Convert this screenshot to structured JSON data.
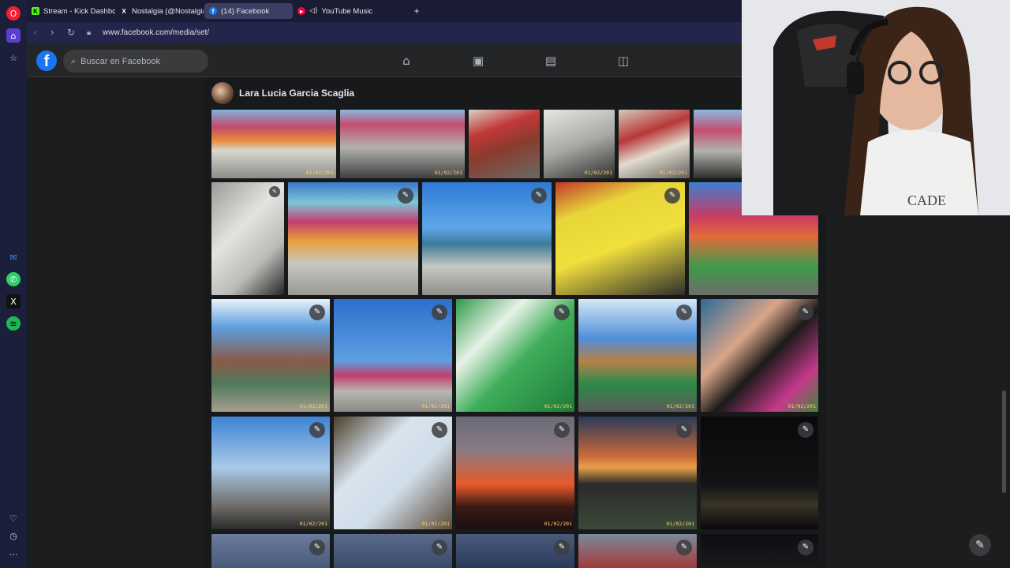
{
  "browser": {
    "tabs": [
      {
        "label": "Stream - Kick Dashboard",
        "icon": "kick-icon",
        "color": "#53fc18"
      },
      {
        "label": "Nostalgia (@NostalgiaFol",
        "icon": "x-icon",
        "color": "#ffffff"
      },
      {
        "label": "(14) Facebook",
        "icon": "facebook-icon",
        "color": "#1877f2"
      },
      {
        "label": "YouTube Music",
        "icon": "youtube-music-icon",
        "color": "#ff0033"
      }
    ],
    "new_tab": "+",
    "url": "www.facebook.com/media/set/"
  },
  "facebook": {
    "logo": "f",
    "search_placeholder": "Buscar en Facebook",
    "nav_icons": [
      "home-icon",
      "video-icon",
      "marketplace-icon",
      "gaming-icon"
    ],
    "album_owner": "Lara Lucia Garcia Scaglia"
  },
  "photos": {
    "row1": [
      {
        "date": "01/02/201"
      },
      {
        "date": "01/02/201"
      },
      {
        "date": ""
      },
      {
        "date": "01/02/201"
      },
      {
        "date": "01/02/201"
      },
      {
        "date": ""
      }
    ],
    "row2": [
      {
        "date": ""
      },
      {
        "date": ""
      },
      {
        "date": ""
      },
      {
        "date": ""
      },
      {
        "date": ""
      }
    ],
    "row3": [
      {
        "date": "01/02/201"
      },
      {
        "date": "01/02/201"
      },
      {
        "date": "01/02/201"
      },
      {
        "date": "01/02/201"
      },
      {
        "date": "01/02/201"
      }
    ],
    "row4": [
      {
        "date": "01/02/201"
      },
      {
        "date": "01/02/201"
      },
      {
        "date": "01/02/201"
      },
      {
        "date": "01/02/201"
      },
      {
        "date": ""
      }
    ]
  },
  "colors": {
    "opera_sidebar": "#1c1f3a",
    "facebook_blue": "#1877f2",
    "page_bg": "#18191a"
  }
}
